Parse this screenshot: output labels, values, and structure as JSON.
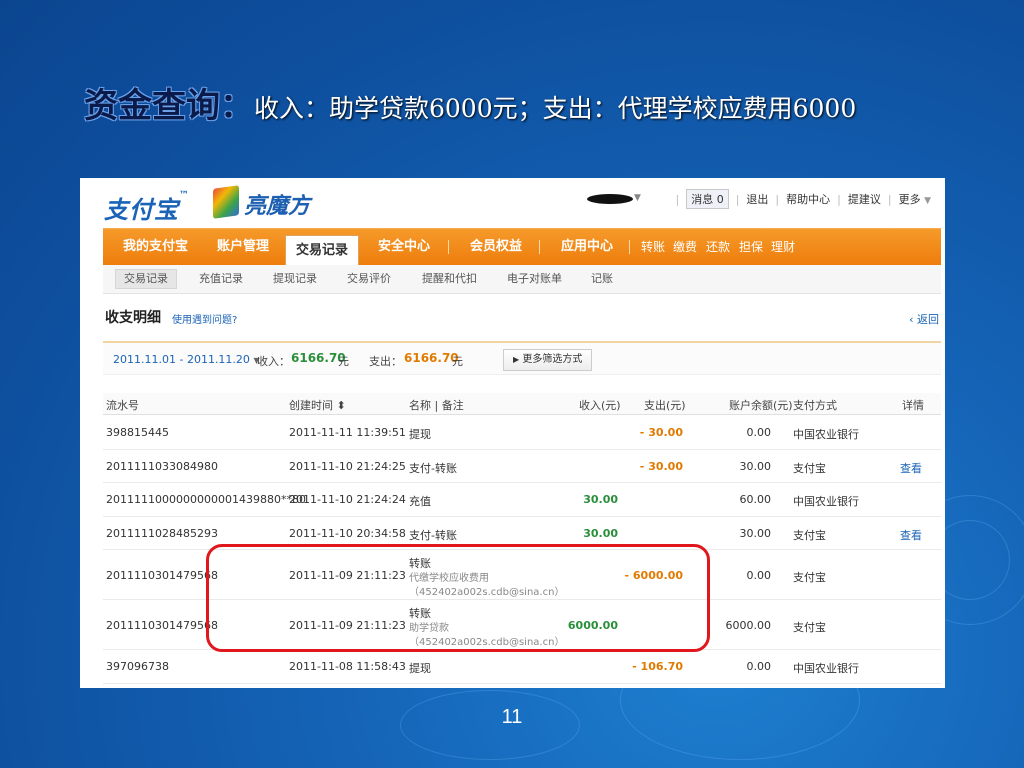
{
  "slide": {
    "title_bold": "资金查询：",
    "title_rest": "收入：助学贷款6000元；支出：代理学校应费用6000",
    "page_number": "11"
  },
  "header": {
    "logo_text": "支付宝",
    "logo_mark": "™",
    "partner_logo": "亮魔方",
    "messages_label": "消息",
    "messages_count": "0",
    "logout": "退出",
    "help_center": "帮助中心",
    "suggestion": "提建议",
    "more": "更多"
  },
  "nav": {
    "items": [
      "我的支付宝",
      "账户管理",
      "交易记录",
      "安全中心",
      "会员权益",
      "应用中心"
    ],
    "active": "交易记录",
    "quick": [
      "转账",
      "缴费",
      "还款",
      "担保",
      "理财"
    ]
  },
  "subnav": {
    "items": [
      "交易记录",
      "充值记录",
      "提现记录",
      "交易评价",
      "提醒和代扣",
      "电子对账单",
      "记账"
    ]
  },
  "page": {
    "heading": "收支明细",
    "help_link": "使用遇到问题?",
    "back_link": "返回"
  },
  "filter": {
    "date_range": "2011.11.01 - 2011.11.20",
    "income_label": "收入：",
    "income_value": "6166.70",
    "expense_label": "支出：",
    "expense_value": "6166.70",
    "unit": "元",
    "more_filter_button": "更多筛选方式"
  },
  "table": {
    "headers": [
      "流水号",
      "创建时间",
      "名称 | 备注",
      "收入(元)",
      "支出(元)",
      "账户余额(元)",
      "支付方式",
      "详情"
    ],
    "rows": [
      {
        "serial": "398815445",
        "time": "2011-11-11 11:39:51",
        "name": "提现",
        "note": "",
        "email": "",
        "income": "",
        "expense": "- 30.00",
        "balance": "0.00",
        "method": "中国农业银行",
        "detail": ""
      },
      {
        "serial": "2011111033084980",
        "time": "2011-11-10 21:24:25",
        "name": "支付-转账",
        "note": "",
        "email": "",
        "income": "",
        "expense": "- 30.00",
        "balance": "30.00",
        "method": "支付宝",
        "detail": "查看"
      },
      {
        "serial": "2011111000000000001439880**80",
        "time": "2011-11-10 21:24:24",
        "name": "充值",
        "note": "",
        "email": "",
        "income": "30.00",
        "expense": "",
        "balance": "60.00",
        "method": "中国农业银行",
        "detail": ""
      },
      {
        "serial": "2011111028485293",
        "time": "2011-11-10 20:34:58",
        "name": "支付-转账",
        "note": "",
        "email": "",
        "income": "30.00",
        "expense": "",
        "balance": "30.00",
        "method": "支付宝",
        "detail": "查看"
      },
      {
        "serial": "2011110301479568",
        "time": "2011-11-09 21:11:23",
        "name": "转账",
        "note": "代缴学校应收费用",
        "email": "（452402a002s.cdb@sina.cn）",
        "income": "",
        "expense": "- 6000.00",
        "balance": "0.00",
        "method": "支付宝",
        "detail": ""
      },
      {
        "serial": "2011110301479568",
        "time": "2011-11-09 21:11:23",
        "name": "转账",
        "note": "助学贷款",
        "email": "（452402a002s.cdb@sina.cn）",
        "income": "6000.00",
        "expense": "",
        "balance": "6000.00",
        "method": "支付宝",
        "detail": ""
      },
      {
        "serial": "397096738",
        "time": "2011-11-08 11:58:43",
        "name": "提现",
        "note": "",
        "email": "",
        "income": "",
        "expense": "- 106.70",
        "balance": "0.00",
        "method": "中国农业银行",
        "detail": ""
      }
    ]
  },
  "colors": {
    "nav_orange": "#ee7d0c",
    "income_green": "#2a8f3a",
    "expense_orange": "#e07a00",
    "link_blue": "#1b63b6",
    "highlight_red": "#e0181e",
    "slide_bg": "#1565b8"
  },
  "icons": {
    "sort": "sort-icon",
    "dropdown": "caret-down-icon",
    "arrow": "triangle-right-icon",
    "back": "chevron-left-icon"
  }
}
